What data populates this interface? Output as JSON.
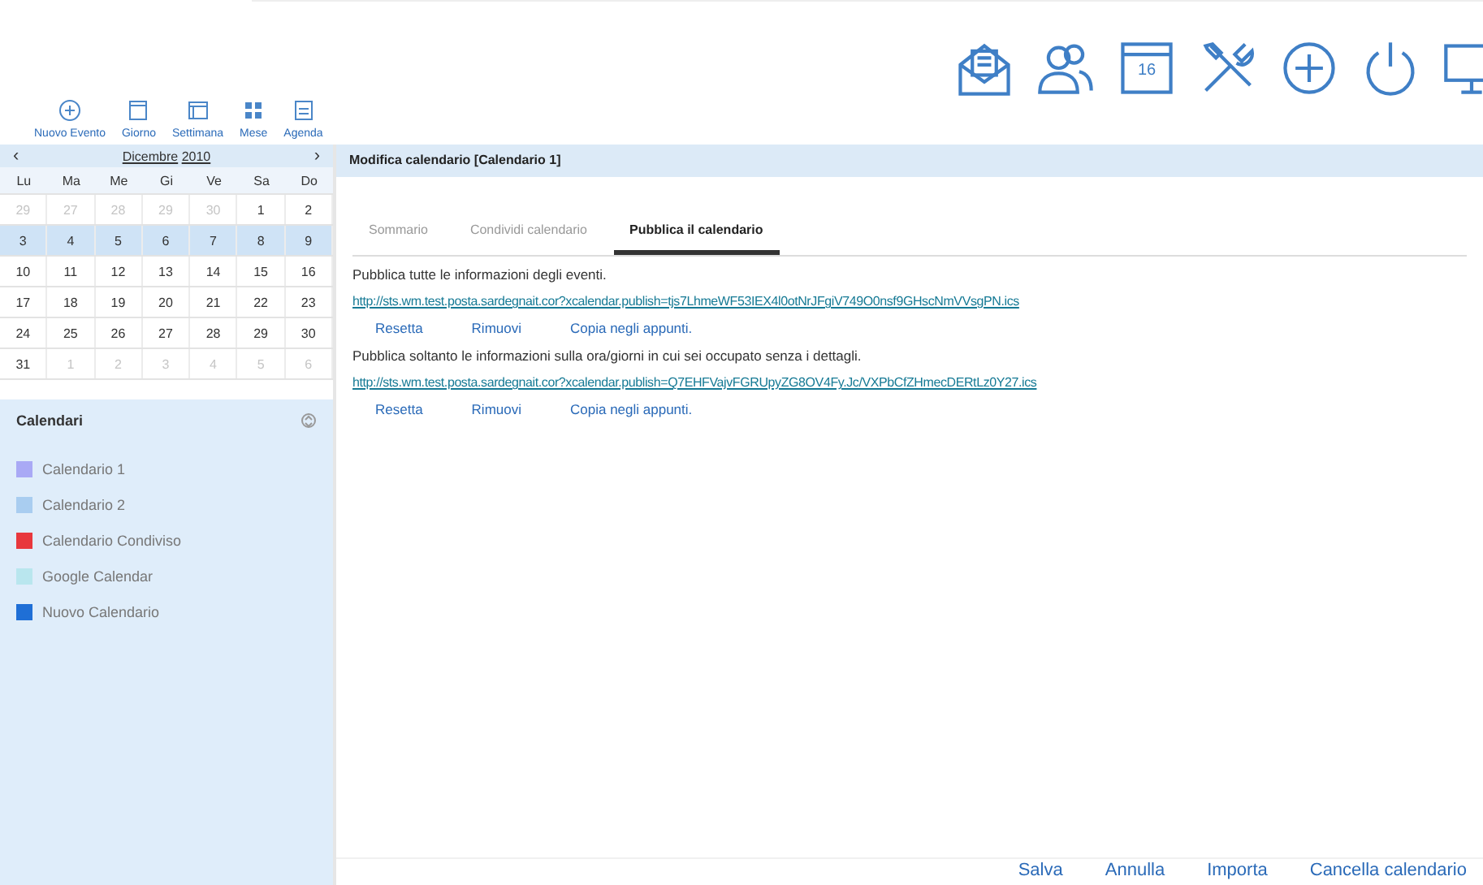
{
  "top_icons": [
    {
      "kind": "mail"
    },
    {
      "kind": "contacts"
    },
    {
      "kind": "calendar",
      "text": "16"
    },
    {
      "kind": "tools"
    },
    {
      "kind": "plus"
    },
    {
      "kind": "power"
    },
    {
      "kind": "monitor"
    }
  ],
  "views": [
    {
      "kind": "plus",
      "label": "Nuovo Evento"
    },
    {
      "kind": "day",
      "label": "Giorno"
    },
    {
      "kind": "week",
      "label": "Settimana"
    },
    {
      "kind": "month",
      "label": "Mese"
    },
    {
      "kind": "agenda",
      "label": "Agenda"
    }
  ],
  "mini_calendar": {
    "prev": "‹",
    "month": "Dicembre",
    "year": "2010",
    "next": "›",
    "weekdays": [
      "Lu",
      "Ma",
      "Me",
      "Gi",
      "Ve",
      "Sa",
      "Do"
    ],
    "weeks": [
      {
        "selected": false,
        "days": [
          {
            "n": "29",
            "other_month": true
          },
          {
            "n": "27",
            "other_month": true
          },
          {
            "n": "28",
            "other_month": true
          },
          {
            "n": "29",
            "other_month": true
          },
          {
            "n": "30",
            "other_month": true
          },
          {
            "n": "1",
            "other_month": false
          },
          {
            "n": "2",
            "other_month": false
          }
        ]
      },
      {
        "selected": true,
        "days": [
          {
            "n": "3",
            "other_month": false
          },
          {
            "n": "4",
            "other_month": false
          },
          {
            "n": "5",
            "other_month": false
          },
          {
            "n": "6",
            "other_month": false
          },
          {
            "n": "7",
            "other_month": false
          },
          {
            "n": "8",
            "other_month": false
          },
          {
            "n": "9",
            "other_month": false
          }
        ]
      },
      {
        "selected": false,
        "days": [
          {
            "n": "10",
            "other_month": false
          },
          {
            "n": "11",
            "other_month": false
          },
          {
            "n": "12",
            "other_month": false
          },
          {
            "n": "13",
            "other_month": false
          },
          {
            "n": "14",
            "other_month": false
          },
          {
            "n": "15",
            "other_month": false
          },
          {
            "n": "16",
            "other_month": false
          }
        ]
      },
      {
        "selected": false,
        "days": [
          {
            "n": "17",
            "other_month": false
          },
          {
            "n": "18",
            "other_month": false
          },
          {
            "n": "19",
            "other_month": false
          },
          {
            "n": "20",
            "other_month": false
          },
          {
            "n": "21",
            "other_month": false
          },
          {
            "n": "22",
            "other_month": false
          },
          {
            "n": "23",
            "other_month": false
          }
        ]
      },
      {
        "selected": false,
        "days": [
          {
            "n": "24",
            "other_month": false
          },
          {
            "n": "25",
            "other_month": false
          },
          {
            "n": "26",
            "other_month": false
          },
          {
            "n": "27",
            "other_month": false
          },
          {
            "n": "28",
            "other_month": false
          },
          {
            "n": "29",
            "other_month": false
          },
          {
            "n": "30",
            "other_month": false
          }
        ]
      },
      {
        "selected": false,
        "days": [
          {
            "n": "31",
            "other_month": false
          },
          {
            "n": "1",
            "other_month": true
          },
          {
            "n": "2",
            "other_month": true
          },
          {
            "n": "3",
            "other_month": true
          },
          {
            "n": "4",
            "other_month": true
          },
          {
            "n": "5",
            "other_month": true
          },
          {
            "n": "6",
            "other_month": true
          }
        ]
      }
    ]
  },
  "calendars": {
    "title": "Calendari",
    "items": [
      {
        "label": "Calendario 1",
        "color": "#a9a9f5"
      },
      {
        "label": "Calendario 2",
        "color": "#a9cdf0"
      },
      {
        "label": "Calendario Condiviso",
        "color": "#e8383d"
      },
      {
        "label": "Google Calendar",
        "color": "#b9e6ee"
      },
      {
        "label": "Nuovo Calendario",
        "color": "#1f6fd6"
      }
    ]
  },
  "panel_title": "Modifica calendario [Calendario 1]",
  "tabs": [
    {
      "label": "Sommario",
      "selected": false
    },
    {
      "label": "Condividi calendario",
      "selected": false
    },
    {
      "label": "Pubblica il calendario",
      "selected": true
    }
  ],
  "sections": [
    {
      "text": "Pubblica tutte le informazioni degli eventi.",
      "url": "http://sts.wm.test.posta.sardegnait.cor?xcalendar.publish=tjs7LhmeWF53IEX4l0otNrJFgiV749O0nsf9GHscNmVVsgPN.ics",
      "actions": [
        "Resetta",
        "Rimuovi",
        "Copia negli appunti."
      ]
    },
    {
      "text": "Pubblica soltanto le informazioni sulla ora/giorni in cui sei occupato senza i dettagli.",
      "url": "http://sts.wm.test.posta.sardegnait.cor?xcalendar.publish=Q7EHFVajvFGRUpyZG8OV4Fy.Jc/VXPbCfZHmecDERtLz0Y27.ics",
      "actions": [
        "Resetta",
        "Rimuovi",
        "Copia negli appunti."
      ]
    }
  ],
  "footer_buttons": [
    "Salva",
    "Annulla",
    "Importa",
    "Cancella calendario"
  ]
}
